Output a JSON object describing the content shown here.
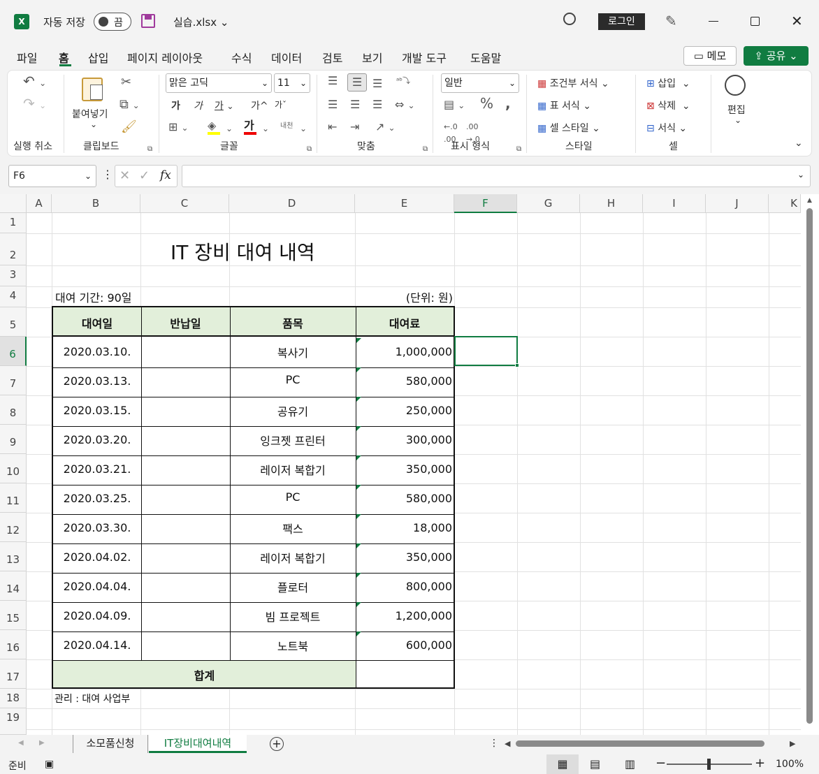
{
  "titlebar": {
    "autosave": "자동 저장",
    "toggle": "끔",
    "filename": "실습.xlsx",
    "login": "로그인"
  },
  "tabs": [
    "파일",
    "홈",
    "삽입",
    "페이지 레이아웃",
    "수식",
    "데이터",
    "검토",
    "보기",
    "개발 도구",
    "도움말"
  ],
  "share": {
    "memo": "메모",
    "share": "공유"
  },
  "ribbon": {
    "undo_group": "실행 취소",
    "clipboard": {
      "paste": "붙여넣기",
      "group": "클립보드"
    },
    "font": {
      "name": "맑은 고딕",
      "size": "11",
      "bold": "가",
      "italic": "가",
      "underline": "가",
      "grow": "가",
      "shrink": "가",
      "group": "글꼴"
    },
    "align": {
      "wrap": "내천",
      "group": "맞춤"
    },
    "number": {
      "format": "일반",
      "group": "표시 형식"
    },
    "styles": {
      "cond": "조건부 서식",
      "table": "표 서식",
      "cell": "셀 스타일",
      "group": "스타일"
    },
    "cells": {
      "insert": "삽입",
      "delete": "삭제",
      "format": "서식",
      "group": "셀"
    },
    "edit": {
      "label": "편집"
    }
  },
  "namebox": "F6",
  "columns": [
    "A",
    "B",
    "C",
    "D",
    "E",
    "F",
    "G",
    "H",
    "I",
    "J",
    "K"
  ],
  "rows": [
    "1",
    "2",
    "3",
    "4",
    "5",
    "6",
    "7",
    "8",
    "9",
    "10",
    "11",
    "12",
    "13",
    "14",
    "15",
    "16",
    "17",
    "18",
    "19"
  ],
  "sheet": {
    "title": "IT 장비 대여 내역",
    "period": "대여 기간: 90일",
    "unit": "(단위: 원)",
    "headers": [
      "대여일",
      "반납일",
      "품목",
      "대여료"
    ],
    "data": [
      {
        "date": "2020.03.10.",
        "item": "복사기",
        "fee": "1,000,000"
      },
      {
        "date": "2020.03.13.",
        "item": "PC",
        "fee": "580,000"
      },
      {
        "date": "2020.03.15.",
        "item": "공유기",
        "fee": "250,000"
      },
      {
        "date": "2020.03.20.",
        "item": "잉크젯 프린터",
        "fee": "300,000"
      },
      {
        "date": "2020.03.21.",
        "item": "레이저 복합기",
        "fee": "350,000"
      },
      {
        "date": "2020.03.25.",
        "item": "PC",
        "fee": "580,000"
      },
      {
        "date": "2020.03.30.",
        "item": "팩스",
        "fee": "18,000"
      },
      {
        "date": "2020.04.02.",
        "item": "레이저 복합기",
        "fee": "350,000"
      },
      {
        "date": "2020.04.04.",
        "item": "플로터",
        "fee": "800,000"
      },
      {
        "date": "2020.04.09.",
        "item": "빔 프로젝트",
        "fee": "1,200,000"
      },
      {
        "date": "2020.04.14.",
        "item": "노트북",
        "fee": "600,000"
      }
    ],
    "total": "합계",
    "note": "관리 : 대여 사업부"
  },
  "sheet_tabs": [
    "소모품신청",
    "IT장비대여내역"
  ],
  "status": {
    "ready": "준비",
    "zoom": "100%"
  },
  "colors": {
    "accent": "#107c41",
    "header_fill": "#e2efda"
  }
}
